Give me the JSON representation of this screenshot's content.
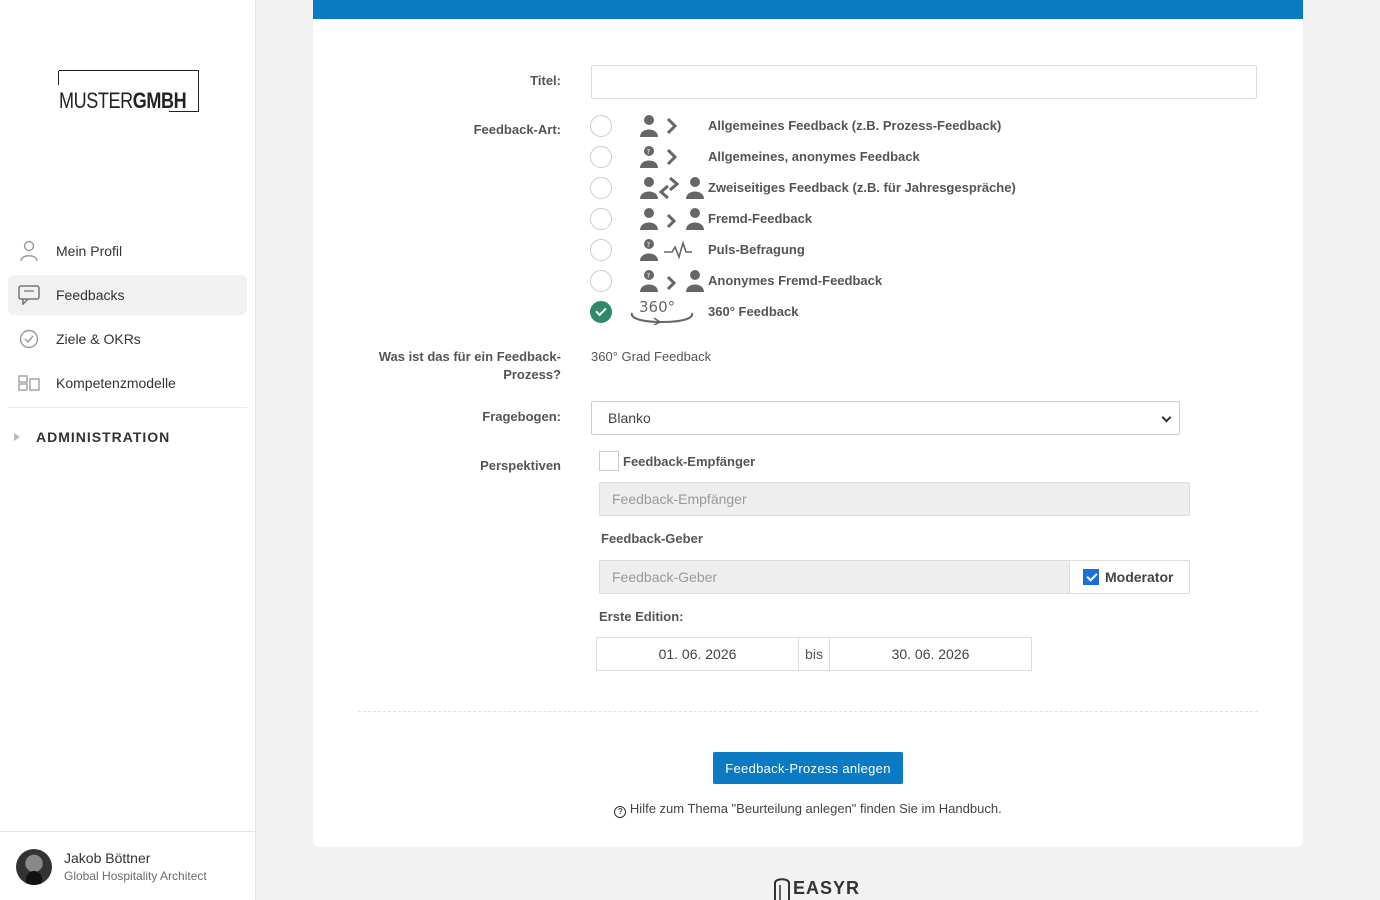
{
  "company_logo": {
    "text_light": "MUSTER",
    "text_bold": "GMBH"
  },
  "sidebar": {
    "items": [
      {
        "label": "Mein Profil",
        "icon": "user-icon"
      },
      {
        "label": "Feedbacks",
        "icon": "chat-icon",
        "active": true
      },
      {
        "label": "Ziele & OKRs",
        "icon": "check-circle-icon"
      },
      {
        "label": "Kompetenzmodelle",
        "icon": "grid-icon"
      }
    ],
    "admin_label": "ADMINISTRATION"
  },
  "user": {
    "name": "Jakob Böttner",
    "role": "Global Hospitality Architect"
  },
  "form": {
    "title_label": "Titel:",
    "title_value": "",
    "type_label": "Feedback-Art:",
    "types": [
      {
        "label": "Allgemeines Feedback (z.B. Prozess-Feedback)",
        "selected": false
      },
      {
        "label": "Allgemeines, anonymes Feedback",
        "selected": false
      },
      {
        "label": "Zweiseitiges Feedback (z.B. für Jahresgespräche)",
        "selected": false
      },
      {
        "label": "Fremd-Feedback",
        "selected": false
      },
      {
        "label": "Puls-Befragung",
        "selected": false
      },
      {
        "label": "Anonymes Fremd-Feedback",
        "selected": false
      },
      {
        "label": "360° Feedback",
        "selected": true
      }
    ],
    "process_label_line1": "Was ist das für ein Feedback-",
    "process_label_line2": "Prozess?",
    "process_value": "360° Grad Feedback",
    "questionnaire_label": "Fragebogen:",
    "questionnaire_value": "Blanko",
    "perspectives_label": "Perspektiven",
    "receiver_checkbox_label": "Feedback-Empfänger",
    "receiver_placeholder": "Feedback-Empfänger",
    "giver_heading": "Feedback-Geber",
    "giver_placeholder": "Feedback-Geber",
    "moderator_label": "Moderator",
    "first_edition_label": "Erste Edition:",
    "date_from": "01. 06. 2026",
    "date_sep": "bis",
    "date_to": "30. 06. 2026",
    "submit_label": "Feedback-Prozess anlegen",
    "help_text": "Hilfe zum Thema \"Beurteilung anlegen\" finden Sie im Handbuch."
  },
  "footer": {
    "brand": "EASYR"
  },
  "colors": {
    "accent": "#0a7bc2",
    "selected_radio": "#2e8a6c",
    "checkbox": "#1c6fd8"
  }
}
